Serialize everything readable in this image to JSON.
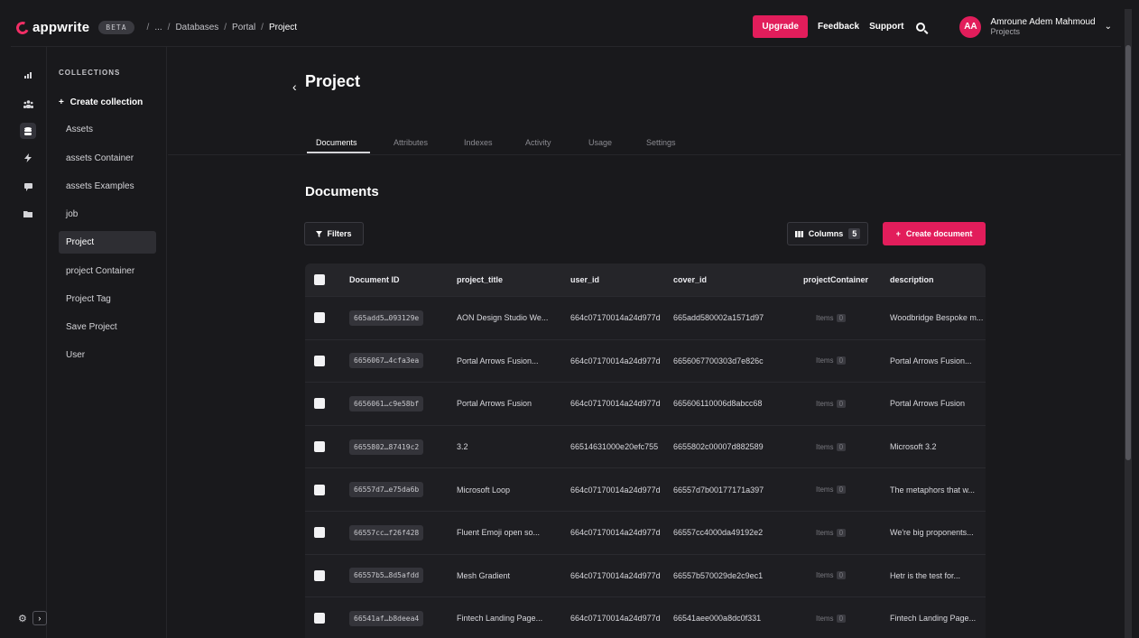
{
  "brand": {
    "name": "appwrite",
    "badge": "BETA"
  },
  "breadcrumb": {
    "items": [
      "/",
      "...",
      "/",
      "Databases",
      "/",
      "Portal",
      "/",
      "Project"
    ]
  },
  "header": {
    "upgrade_label": "Upgrade",
    "feedback_label": "Feedback",
    "support_label": "Support",
    "avatar_initials": "AA",
    "user_name": "Amroune Adem Mahmoud",
    "user_sub": "Projects"
  },
  "rail": {
    "icons": [
      "chart-icon",
      "users-icon",
      "database-icon",
      "functions-icon",
      "messaging-icon",
      "storage-icon"
    ]
  },
  "collections": {
    "title": "COLLECTIONS",
    "create_label": "Create collection",
    "items": [
      "Assets",
      "assets Container",
      "assets Examples",
      "job",
      "Project",
      "project Container",
      "Project Tag",
      "Save Project",
      "User"
    ],
    "active": "Project"
  },
  "page": {
    "title": "Project",
    "tabs": [
      "Documents",
      "Attributes",
      "Indexes",
      "Activity",
      "Usage",
      "Settings"
    ],
    "section_title": "Documents",
    "filters_label": "Filters",
    "columns_label": "Columns",
    "columns_count": "5",
    "create_label": "Create document"
  },
  "table": {
    "headers": [
      "Document ID",
      "project_title",
      "user_id",
      "cover_id",
      "projectContainer",
      "description"
    ],
    "items_label": "Items",
    "items_count": "0",
    "rows": [
      [
        "665add5…093129e",
        "AON Design Studio We...",
        "664c07170014a24d977d",
        "665add580002a1571d97",
        "Woodbridge Bespoke m..."
      ],
      [
        "6656067…4cfa3ea",
        "Portal Arrows Fusion...",
        "664c07170014a24d977d",
        "6656067700303d7e826c",
        "Portal Arrows Fusion..."
      ],
      [
        "6656061…c9e58bf",
        "Portal Arrows Fusion",
        "664c07170014a24d977d",
        "665606110006d8abcc68",
        "Portal Arrows Fusion"
      ],
      [
        "6655802…87419c2",
        "3.2",
        "66514631000e20efc755",
        "6655802c00007d882589",
        "Microsoft 3.2"
      ],
      [
        "66557d7…e75da6b",
        "Microsoft Loop",
        "664c07170014a24d977d",
        "66557d7b00177171a397",
        "The metaphors that w..."
      ],
      [
        "66557cc…f26f428",
        "Fluent Emoji open so...",
        "664c07170014a24d977d",
        "66557cc4000da49192e2",
        "We're big proponents..."
      ],
      [
        "66557b5…8d5afdd",
        "Mesh Gradient",
        "664c07170014a24d977d",
        "66557b570029de2c9ec1",
        "Hetr is the test for..."
      ],
      [
        "66541af…b8deea4",
        "Fintech Landing Page...",
        "664c07170014a24d977d",
        "66541aee000a8dc0f331",
        "Fintech Landing Page..."
      ]
    ]
  }
}
